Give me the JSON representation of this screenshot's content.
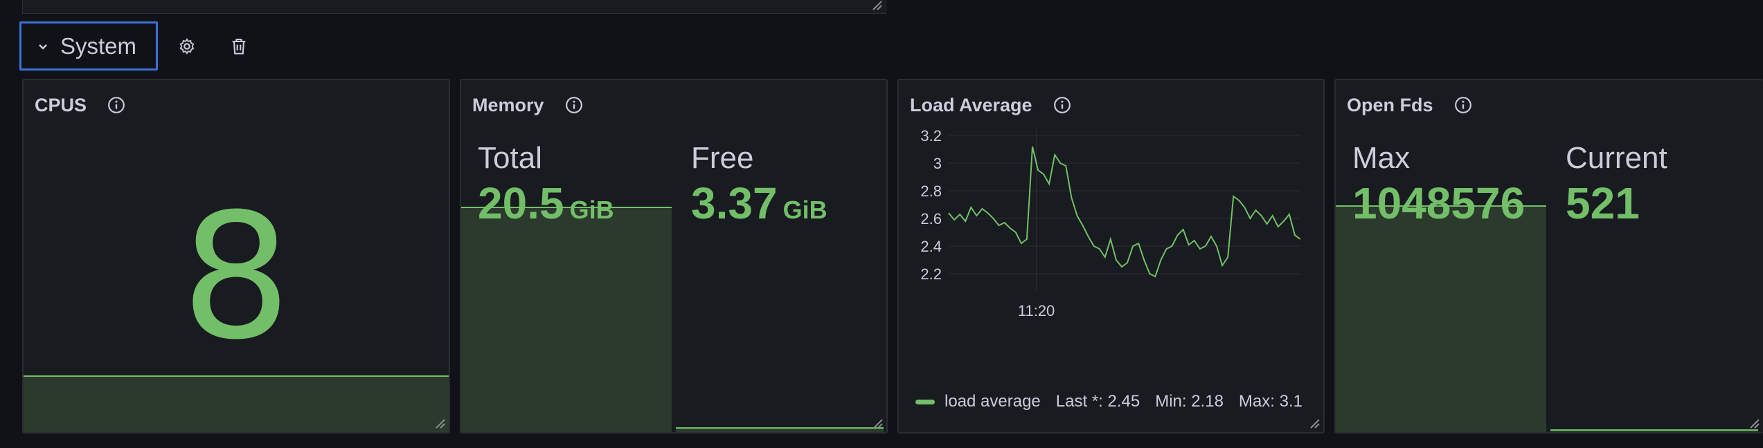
{
  "row": {
    "title": "System",
    "icons": [
      "chevron-down-icon",
      "gear-icon",
      "trash-icon"
    ]
  },
  "panels": {
    "cpus": {
      "title": "CPUS",
      "value": "8"
    },
    "memory": {
      "title": "Memory",
      "total_label": "Total",
      "total_value": "20.5",
      "total_unit": "GiB",
      "free_label": "Free",
      "free_value": "3.37",
      "free_unit": "GiB"
    },
    "load": {
      "title": "Load Average",
      "legend": {
        "name": "load average",
        "last": "Last *: 2.45",
        "min": "Min: 2.18",
        "max": "Max: 3.1"
      }
    },
    "fds": {
      "title": "Open Fds",
      "max_label": "Max",
      "max_value": "1048576",
      "current_label": "Current",
      "current_value": "521"
    }
  },
  "colors": {
    "accent": "#73bf69",
    "selection": "#3d71d9",
    "panel_bg": "#181b1f"
  },
  "chart_data": {
    "type": "line",
    "title": "Load Average",
    "xlabel": "",
    "ylabel": "",
    "x_ticks": [
      "11:20"
    ],
    "y_ticks": [
      2.2,
      2.4,
      2.6,
      2.8,
      3,
      3.2
    ],
    "ylim": [
      2.1,
      3.25
    ],
    "grid": true,
    "legend_placement": "bottom-left",
    "series": [
      {
        "name": "load average",
        "values": [
          2.64,
          2.59,
          2.63,
          2.58,
          2.68,
          2.62,
          2.67,
          2.64,
          2.6,
          2.55,
          2.57,
          2.53,
          2.5,
          2.42,
          2.45,
          3.12,
          2.95,
          2.92,
          2.85,
          3.06,
          3.0,
          2.98,
          2.75,
          2.62,
          2.55,
          2.47,
          2.4,
          2.38,
          2.32,
          2.45,
          2.3,
          2.25,
          2.28,
          2.4,
          2.42,
          2.3,
          2.2,
          2.18,
          2.3,
          2.38,
          2.4,
          2.48,
          2.52,
          2.41,
          2.44,
          2.38,
          2.4,
          2.47,
          2.4,
          2.26,
          2.32,
          2.76,
          2.73,
          2.68,
          2.6,
          2.66,
          2.62,
          2.56,
          2.62,
          2.54,
          2.58,
          2.63,
          2.48,
          2.45
        ]
      }
    ]
  }
}
